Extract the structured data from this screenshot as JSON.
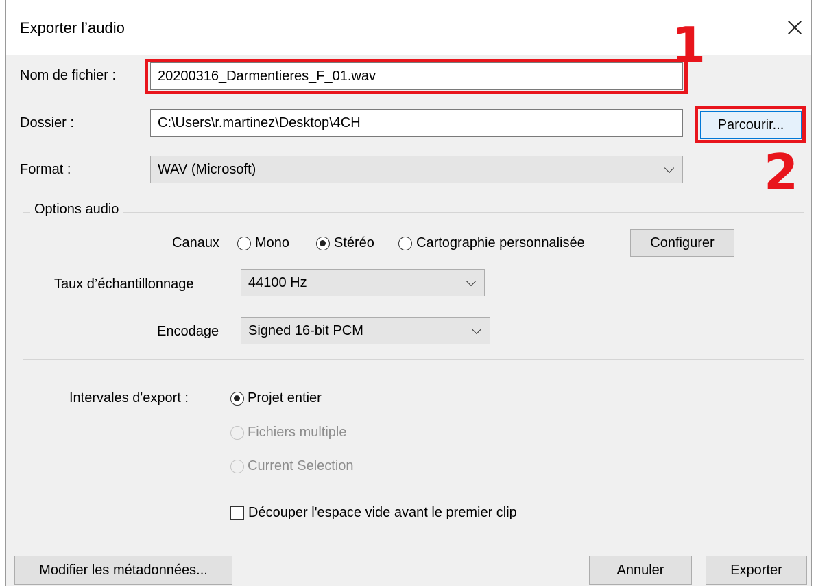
{
  "window": {
    "title": "Exporter l’audio"
  },
  "annotations": {
    "one": "1",
    "two": "2"
  },
  "file": {
    "name_label": "Nom de fichier :",
    "name_value": "20200316_Darmentieres_F_01.wav",
    "folder_label": "Dossier :",
    "folder_value": "C:\\Users\\r.martinez\\Desktop\\4CH",
    "browse_label": "Parcourir...",
    "format_label": "Format :",
    "format_value": "WAV (Microsoft)"
  },
  "audio_options": {
    "legend": "Options audio",
    "channels_label": "Canaux",
    "channel_options": [
      "Mono",
      "Stéréo",
      "Cartographie personnalisée"
    ],
    "channel_selected": "Stéréo",
    "configure_label": "Configurer",
    "sample_rate_label": "Taux d’échantillonnage",
    "sample_rate_value": "44100 Hz",
    "encoding_label": "Encodage",
    "encoding_value": "Signed 16-bit PCM"
  },
  "export_range": {
    "label": "Intervales d'export :",
    "options": [
      {
        "label": "Projet entier",
        "selected": true,
        "enabled": true
      },
      {
        "label": "Fichiers multiple",
        "selected": false,
        "enabled": false
      },
      {
        "label": "Current Selection",
        "selected": false,
        "enabled": false
      }
    ]
  },
  "trim": {
    "label": "Découper l'espace vide avant le premier clip",
    "checked": false
  },
  "buttons": {
    "metadata": "Modifier les métadonnées...",
    "cancel": "Annuler",
    "export": "Exporter"
  },
  "colors": {
    "annotation_red": "#e8151c",
    "focus_blue": "#0078d7"
  }
}
